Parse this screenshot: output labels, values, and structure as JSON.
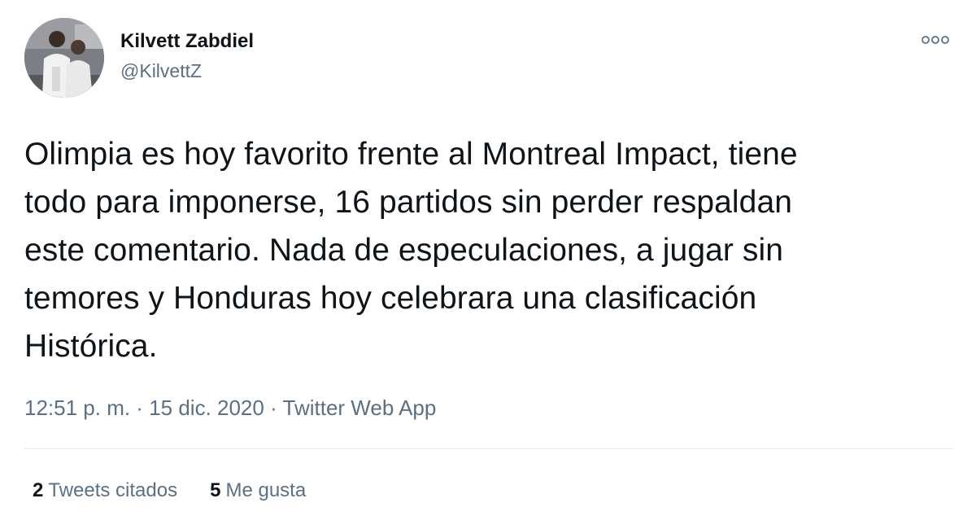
{
  "author": {
    "display_name": "Kilvett Zabdiel",
    "handle": "@KilvettZ"
  },
  "more_icon": "more-horizontal-icon",
  "tweet": {
    "lines": [
      "Olimpia es hoy favorito frente al Montreal Impact, tiene",
      "todo para imponerse, 16 partidos sin perder respaldan",
      "este comentario. Nada de especulaciones, a jugar sin",
      "temores y Honduras hoy celebrara una clasificación",
      "Histórica."
    ]
  },
  "meta": {
    "time": "12:51 p. m.",
    "separator": " · ",
    "date": "15 dic. 2020",
    "source": "Twitter Web App"
  },
  "stats": {
    "quotes_count": "2",
    "quotes_label": "Tweets citados",
    "likes_count": "5",
    "likes_label": "Me gusta"
  },
  "colors": {
    "text_primary": "#0f1419",
    "text_secondary": "#5b7083",
    "divider": "#e6ecf0"
  }
}
